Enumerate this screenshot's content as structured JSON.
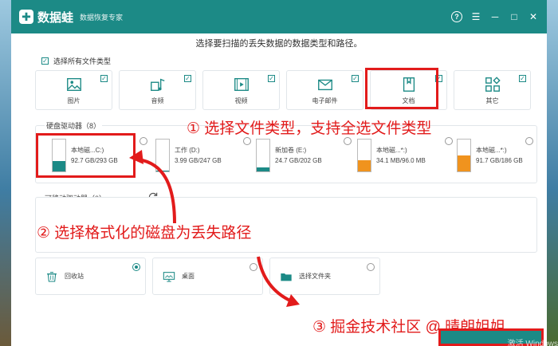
{
  "app": {
    "logo": "✚",
    "name": "数据蛙",
    "subtitle": "数据恢复专家"
  },
  "window_controls": {
    "help": "?",
    "menu": "☰",
    "minimize": "─",
    "maximize": "□",
    "close": "✕"
  },
  "heading": "选择要扫描的丢失数据的数据类型和路径。",
  "select_all": {
    "label": "选择所有文件类型",
    "checked": true
  },
  "file_types": [
    {
      "label": "图片",
      "icon": "image-icon",
      "checked": true
    },
    {
      "label": "音频",
      "icon": "audio-icon",
      "checked": true
    },
    {
      "label": "视频",
      "icon": "video-icon",
      "checked": true
    },
    {
      "label": "电子邮件",
      "icon": "email-icon",
      "checked": true
    },
    {
      "label": "文档",
      "icon": "document-icon",
      "checked": true
    },
    {
      "label": "其它",
      "icon": "other-icon",
      "checked": true
    }
  ],
  "hard_drives": {
    "title": "硬盘驱动器（8）",
    "items": [
      {
        "name": "本地磁...C:)",
        "size": "92.7 GB/293 GB",
        "fill": 0.32,
        "color": "#1c8a86",
        "selected": false
      },
      {
        "name": "工作 (D:)",
        "size": "3.99 GB/247 GB",
        "fill": 0.02,
        "color": "#1c8a86",
        "selected": false
      },
      {
        "name": "新加卷 (E:)",
        "size": "24.7 GB/202 GB",
        "fill": 0.12,
        "color": "#1c8a86",
        "selected": false
      },
      {
        "name": "本地磁...*:)",
        "size": "34.1 MB/96.0 MB",
        "fill": 0.36,
        "color": "#f0931e",
        "selected": false
      },
      {
        "name": "本地磁...*:)",
        "size": "91.7 GB/186 GB",
        "fill": 0.49,
        "color": "#f0931e",
        "selected": false
      }
    ]
  },
  "removable": {
    "title": "可移动驱动器（0）"
  },
  "locations": [
    {
      "label": "回收站",
      "icon": "recycle-bin-icon",
      "selected": true
    },
    {
      "label": "桌面",
      "icon": "desktop-icon",
      "selected": false
    },
    {
      "label": "选择文件夹",
      "icon": "folder-icon",
      "selected": false
    }
  ],
  "annotations": {
    "step1": "① 选择文件类型，支持全选文件类型",
    "step2": "② 选择格式化的磁盘为丢失路径",
    "step3": "③ 掘金技术社区 @ 晴朗姐姐"
  },
  "credit": "",
  "windows_watermark": "激活 Windows",
  "colors": {
    "brand": "#1c8a86",
    "annotation": "#e21b1b",
    "partition_warn": "#f0931e"
  }
}
